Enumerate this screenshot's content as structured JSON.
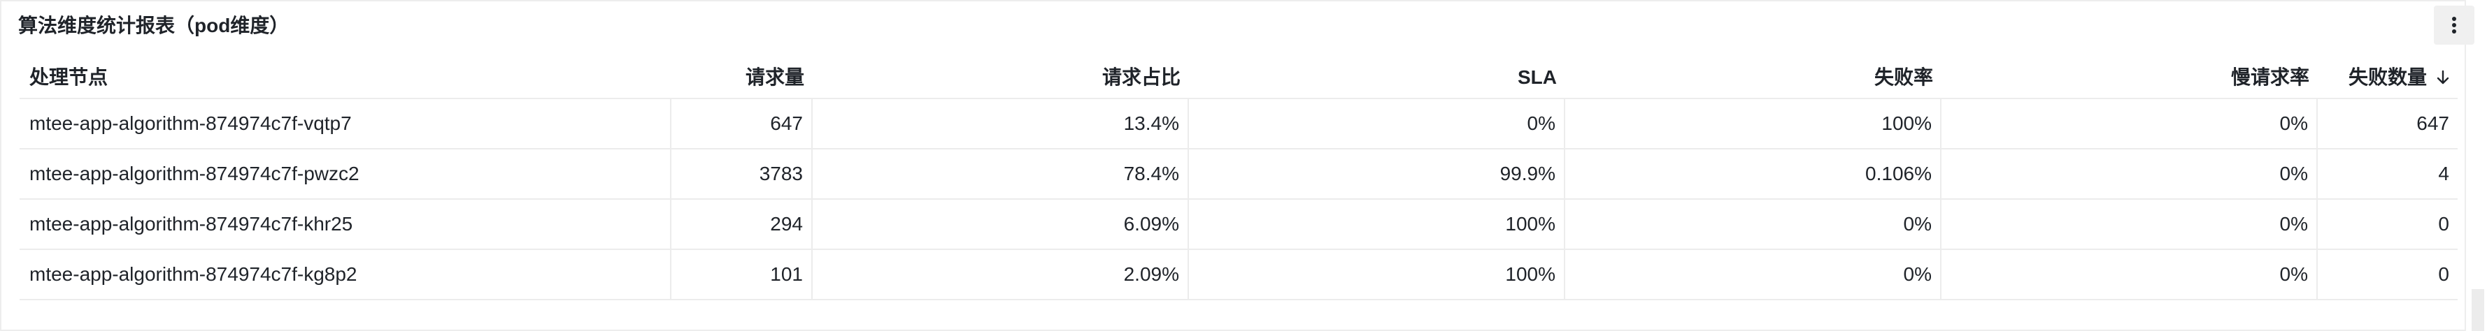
{
  "panel": {
    "title": "算法维度统计报表（pod维度）",
    "menu_icon": "kebab-vertical-icon"
  },
  "table": {
    "columns": [
      {
        "label": "处理节点"
      },
      {
        "label": "请求量"
      },
      {
        "label": "请求占比"
      },
      {
        "label": "SLA"
      },
      {
        "label": "失败率"
      },
      {
        "label": "慢请求率"
      },
      {
        "label": "失败数量",
        "sorted": "descending",
        "sort_icon": "arrow-down-icon"
      }
    ],
    "rows": [
      [
        "mtee-app-algorithm-874974c7f-vqtp7",
        "647",
        "13.4%",
        "0%",
        "100%",
        "0%",
        "647"
      ],
      [
        "mtee-app-algorithm-874974c7f-pwzc2",
        "3783",
        "78.4%",
        "99.9%",
        "0.106%",
        "0%",
        "4"
      ],
      [
        "mtee-app-algorithm-874974c7f-khr25",
        "294",
        "6.09%",
        "100%",
        "0%",
        "0%",
        "0"
      ],
      [
        "mtee-app-algorithm-874974c7f-kg8p2",
        "101",
        "2.09%",
        "100%",
        "0%",
        "0%",
        "0"
      ]
    ]
  }
}
